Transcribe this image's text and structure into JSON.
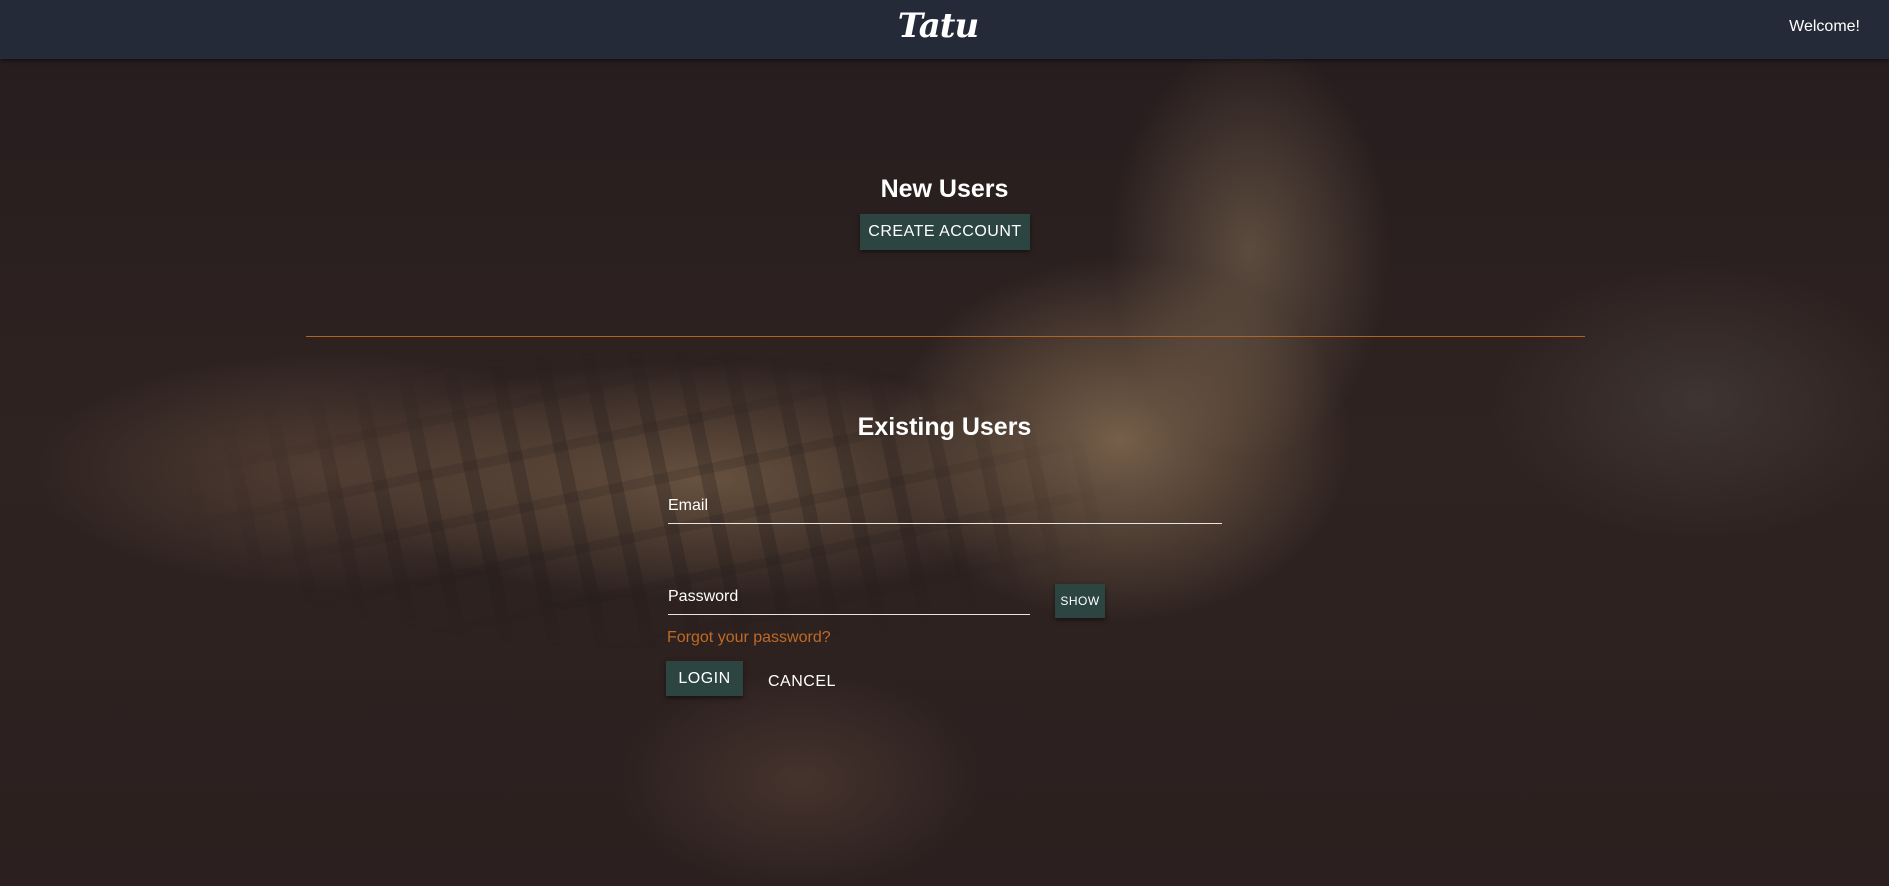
{
  "header": {
    "brand": "Tatu",
    "welcome": "Welcome!"
  },
  "new_users": {
    "heading": "New Users",
    "create_account_label": "CREATE ACCOUNT"
  },
  "existing_users": {
    "heading": "Existing Users",
    "email_placeholder": "Email",
    "email_value": "",
    "password_placeholder": "Password",
    "password_value": "",
    "show_label": "SHOW",
    "forgot_label": "Forgot your password?",
    "login_label": "LOGIN",
    "cancel_label": "CANCEL"
  },
  "colors": {
    "navbar": "#252a38",
    "button": "#2c4541",
    "accent": "#c06a25",
    "divider": "#b5621f"
  }
}
